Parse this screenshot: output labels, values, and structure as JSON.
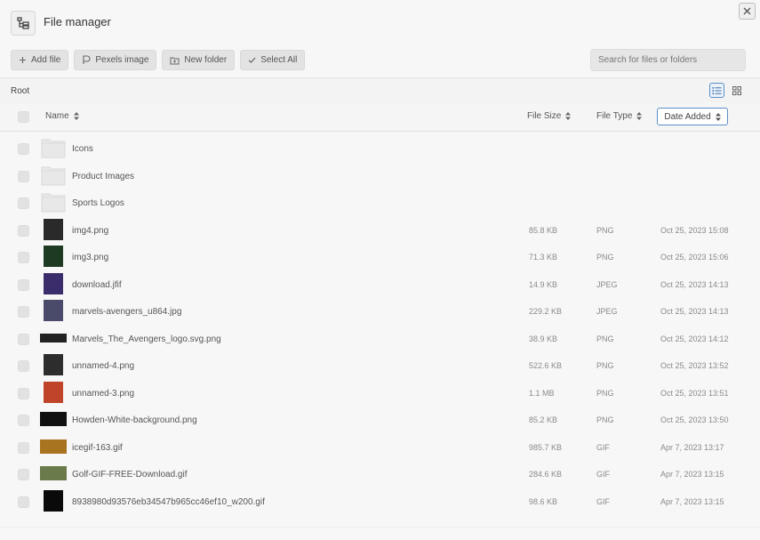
{
  "header": {
    "title": "File manager",
    "app_icon": "folder-tree-icon",
    "close_icon": "close-icon"
  },
  "toolbar": {
    "buttons": [
      {
        "label": "Add file",
        "icon": "plus-icon"
      },
      {
        "label": "Pexels image",
        "icon": "pexels-icon"
      },
      {
        "label": "New folder",
        "icon": "folder-plus-icon"
      },
      {
        "label": "Select All",
        "icon": "check-icon"
      }
    ],
    "search_placeholder": "Search for files or folders"
  },
  "breadcrumb": {
    "path": "Root"
  },
  "view_modes": [
    {
      "name": "list-view",
      "icon": "list-icon",
      "active": true
    },
    {
      "name": "grid-view",
      "icon": "grid-icon",
      "active": false
    }
  ],
  "columns": {
    "name": "Name",
    "size": "File Size",
    "type": "File Type",
    "date": "Date Added"
  },
  "colors": {
    "accent": "#5c8fc9",
    "folder": "#e8e8e8",
    "muted_text": "#8a8a8a"
  },
  "files": [
    {
      "kind": "folder",
      "name": "Icons",
      "size": "",
      "type": "",
      "date": ""
    },
    {
      "kind": "folder",
      "name": "Product Images",
      "size": "",
      "type": "",
      "date": ""
    },
    {
      "kind": "folder",
      "name": "Sports Logos",
      "size": "",
      "type": "",
      "date": ""
    },
    {
      "kind": "image",
      "name": "img4.png",
      "size": "85.8 KB",
      "type": "PNG",
      "date": "Oct 25, 2023 15:08",
      "thumb": "#2a2a2a"
    },
    {
      "kind": "image",
      "name": "img3.png",
      "size": "71.3 KB",
      "type": "PNG",
      "date": "Oct 25, 2023 15:06",
      "thumb": "#1f3a22"
    },
    {
      "kind": "image",
      "name": "download.jfif",
      "size": "14.9 KB",
      "type": "JPEG",
      "date": "Oct 25, 2023 14:13",
      "thumb": "#3b2d6b"
    },
    {
      "kind": "image",
      "name": "marvels-avengers_u864.jpg",
      "size": "229.2 KB",
      "type": "JPEG",
      "date": "Oct 25, 2023 14:13",
      "thumb": "#4a4a6a"
    },
    {
      "kind": "image",
      "name": "Marvels_The_Avengers_logo.svg.png",
      "size": "38.9 KB",
      "type": "PNG",
      "date": "Oct 25, 2023 14:12",
      "thumb": "#ffffff"
    },
    {
      "kind": "image",
      "name": "unnamed-4.png",
      "size": "522.6 KB",
      "type": "PNG",
      "date": "Oct 25, 2023 13:52",
      "thumb": "#2d2d2d"
    },
    {
      "kind": "image",
      "name": "unnamed-3.png",
      "size": "1.1 MB",
      "type": "PNG",
      "date": "Oct 25, 2023 13:51",
      "thumb": "#c0442a"
    },
    {
      "kind": "image",
      "name": "Howden-White-background.png",
      "size": "85.2 KB",
      "type": "PNG",
      "date": "Oct 25, 2023 13:50",
      "thumb": "#111111"
    },
    {
      "kind": "image",
      "name": "icegif-163.gif",
      "size": "985.7 KB",
      "type": "GIF",
      "date": "Apr 7, 2023 13:17",
      "thumb": "#a8741f"
    },
    {
      "kind": "image",
      "name": "Golf-GIF-FREE-Download.gif",
      "size": "284.6 KB",
      "type": "GIF",
      "date": "Apr 7, 2023 13:15",
      "thumb": "#6a7a4a"
    },
    {
      "kind": "image",
      "name": "8938980d93576eb34547b965cc46ef10_w200.gif",
      "size": "98.6 KB",
      "type": "GIF",
      "date": "Apr 7, 2023 13:15",
      "thumb": "#0a0a0a"
    }
  ]
}
